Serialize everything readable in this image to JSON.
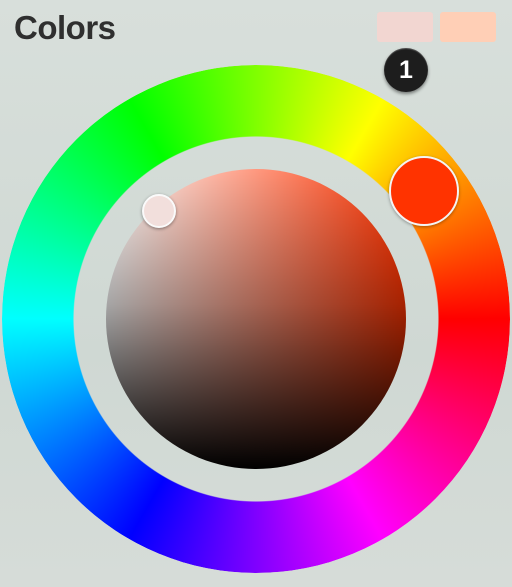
{
  "panel": {
    "title": "Colors",
    "badge_number": "1"
  },
  "swatches": {
    "primary": {
      "color": "#f2d6d1",
      "icon": "primary-color-swatch"
    },
    "secondary": {
      "color": "#ffcfb6",
      "icon": "secondary-color-swatch"
    }
  },
  "picker": {
    "type": "color-wheel",
    "hue_ring_colors": [
      "#ff0000",
      "#ff00ff",
      "#0000ff",
      "#00ffff",
      "#00ff00",
      "#ffff00"
    ],
    "inner_base_color": "#ff3300",
    "selected_hue_color": "#ff3300",
    "selected_color": "#f2dfdc"
  }
}
